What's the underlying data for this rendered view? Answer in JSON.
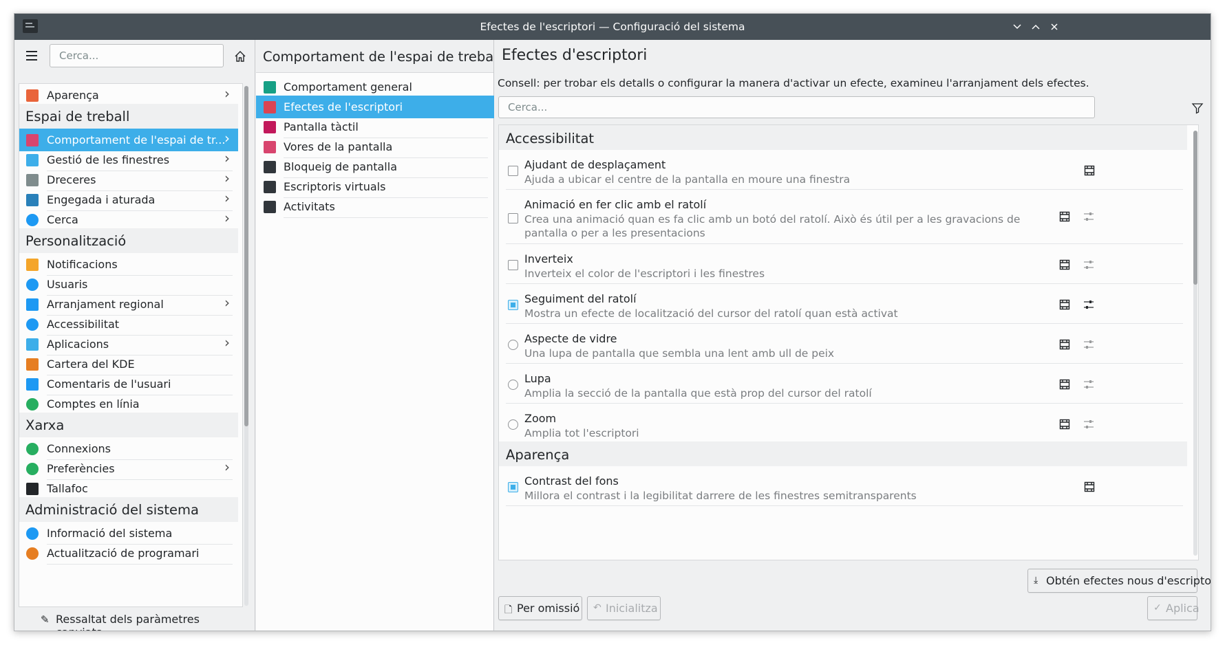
{
  "window": {
    "title": "Efectes de l'escriptori — Configuració del sistema",
    "minimize_icon": "chevron-down",
    "maximize_icon": "chevron-up",
    "close_icon": "×"
  },
  "sidebar": {
    "search_placeholder": "Cerca...",
    "items": [
      {
        "type": "item",
        "label": "Aparença",
        "icon": "appearance",
        "color": "#e9643a",
        "chevron": true
      },
      {
        "type": "category",
        "label": "Espai de treball"
      },
      {
        "type": "item",
        "label": "Comportament de l'espai de tr...",
        "icon": "workspace",
        "color": "#d8456e",
        "chevron": true,
        "active": true
      },
      {
        "type": "item",
        "label": "Gestió de les finestres",
        "icon": "window",
        "color": "#3daee9",
        "chevron": true
      },
      {
        "type": "item",
        "label": "Dreceres",
        "icon": "keyboard",
        "color": "#7f8c8d",
        "chevron": true
      },
      {
        "type": "item",
        "label": "Engegada i aturada",
        "icon": "monitor",
        "color": "#2980b9",
        "chevron": true
      },
      {
        "type": "item",
        "label": "Cerca",
        "icon": "search",
        "color": "#1d99f3",
        "chevron": true
      },
      {
        "type": "category",
        "label": "Personalització"
      },
      {
        "type": "item",
        "label": "Notificacions",
        "icon": "bell",
        "color": "#f4a52a",
        "chevron": false
      },
      {
        "type": "item",
        "label": "Usuaris",
        "icon": "users",
        "color": "#1d99f3",
        "chevron": false
      },
      {
        "type": "item",
        "label": "Arranjament regional",
        "icon": "regional",
        "color": "#1d99f3",
        "chevron": true
      },
      {
        "type": "item",
        "label": "Accessibilitat",
        "icon": "accessibility",
        "color": "#1d99f3",
        "chevron": false
      },
      {
        "type": "item",
        "label": "Aplicacions",
        "icon": "applications",
        "color": "#3daee9",
        "chevron": true
      },
      {
        "type": "item",
        "label": "Cartera del KDE",
        "icon": "wallet",
        "color": "#e67e22",
        "chevron": false
      },
      {
        "type": "item",
        "label": "Comentaris de l'usuari",
        "icon": "feedback",
        "color": "#1d99f3",
        "chevron": false
      },
      {
        "type": "item",
        "label": "Comptes en línia",
        "icon": "globe",
        "color": "#27ae60",
        "chevron": false
      },
      {
        "type": "category",
        "label": "Xarxa"
      },
      {
        "type": "item",
        "label": "Connexions",
        "icon": "globe",
        "color": "#27ae60",
        "chevron": false
      },
      {
        "type": "item",
        "label": "Preferències",
        "icon": "globe",
        "color": "#27ae60",
        "chevron": true
      },
      {
        "type": "item",
        "label": "Tallafoc",
        "icon": "shield",
        "color": "#232629",
        "chevron": false
      },
      {
        "type": "category",
        "label": "Administració del sistema"
      },
      {
        "type": "item",
        "label": "Informació del sistema",
        "icon": "info",
        "color": "#1d99f3",
        "chevron": false
      },
      {
        "type": "item",
        "label": "Actualització de programari",
        "icon": "update",
        "color": "#e67e22",
        "chevron": false
      }
    ],
    "footer_label": "Ressaltat dels paràmetres canviats"
  },
  "middle": {
    "header": "Comportament de l'espai de treball",
    "items": [
      {
        "label": "Comportament general",
        "color": "#16a085"
      },
      {
        "label": "Efectes de l'escriptori",
        "color": "#da4453",
        "active": true
      },
      {
        "label": "Pantalla tàctil",
        "color": "#c2185b"
      },
      {
        "label": "Vores de la pantalla",
        "color": "#d8456e"
      },
      {
        "label": "Bloqueig de pantalla",
        "color": "#31363b"
      },
      {
        "label": "Escriptoris virtuals",
        "color": "#31363b"
      },
      {
        "label": "Activitats",
        "color": "#31363b"
      }
    ]
  },
  "right": {
    "title": "Efectes d'escriptori",
    "tip": "Consell: per trobar els detalls o configurar la manera d'activar un efecte, examineu l'arranjament dels efectes.",
    "search_placeholder": "Cerca...",
    "categories": [
      {
        "label": "Accessibilitat"
      },
      {
        "label": "Aparença"
      }
    ],
    "effects": [
      {
        "name": "Ajudant de desplaçament",
        "desc": "Ajuda a ubicar el centre de la pantalla en moure una finestra",
        "control": "checkbox",
        "checked": false,
        "configurable": false
      },
      {
        "name": "Animació en fer clic amb el ratolí",
        "desc": "Crea una animació quan es fa clic amb un botó del ratolí. Això és útil per a les gravacions de pantalla o per a les presentacions",
        "control": "checkbox",
        "checked": false,
        "configurable": true
      },
      {
        "name": "Inverteix",
        "desc": "Inverteix el color de l'escriptori i les finestres",
        "control": "checkbox",
        "checked": false,
        "configurable": true
      },
      {
        "name": "Seguiment del ratolí",
        "desc": "Mostra un efecte de localització del cursor del ratolí quan està activat",
        "control": "checkbox",
        "checked": true,
        "configurable": true
      },
      {
        "name": "Aspecte de vidre",
        "desc": "Una lupa de pantalla que sembla una lent amb ull de peix",
        "control": "radio",
        "checked": false,
        "configurable": true
      },
      {
        "name": "Lupa",
        "desc": "Amplia la secció de la pantalla que està prop del cursor del ratolí",
        "control": "radio",
        "checked": false,
        "configurable": true
      },
      {
        "name": "Zoom",
        "desc": "Amplia tot l'escriptori",
        "control": "radio",
        "checked": false,
        "configurable": true
      },
      {
        "name": "Contrast del fons",
        "desc": "Millora el contrast i la legibilitat darrere de les finestres semitransparents",
        "control": "checkbox",
        "checked": true,
        "configurable": false
      }
    ],
    "get_new_label": "Obtén efectes nous d'escriptori...",
    "defaults_label": "Per omissió",
    "reset_label": "Inicialitza",
    "apply_label": "Aplica"
  }
}
